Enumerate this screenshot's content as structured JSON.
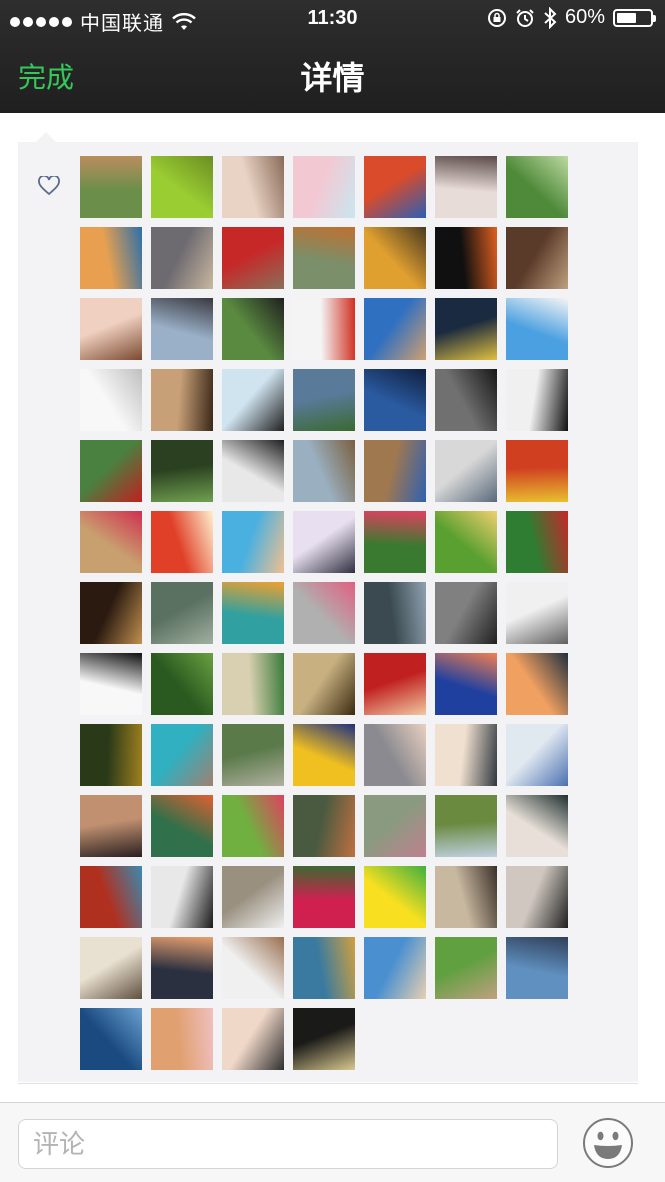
{
  "status_bar": {
    "carrier": "中国联通",
    "time": "11:30",
    "battery_percent": "60%",
    "battery_level": 0.6,
    "icons": [
      "signal-dots-icon",
      "wifi-icon",
      "orientation-lock-icon",
      "alarm-icon",
      "bluetooth-icon",
      "battery-icon"
    ]
  },
  "nav": {
    "done_label": "完成",
    "title": "详情"
  },
  "likes": {
    "icon": "heart-icon",
    "avatars": [
      {
        "c1": "#6b8f4a",
        "c2": "#b98d5e"
      },
      {
        "c1": "#9acd32",
        "c2": "#6b8e23"
      },
      {
        "c1": "#e9d3c4",
        "c2": "#8a6b5a"
      },
      {
        "c1": "#f2c9d3",
        "c2": "#c9e6f0"
      },
      {
        "c1": "#d94b2b",
        "c2": "#2b5fb5"
      },
      {
        "c1": "#e8dcd8",
        "c2": "#5a4a48"
      },
      {
        "c1": "#4f8a3a",
        "c2": "#bcd9a0"
      },
      {
        "c1": "#e8a050",
        "c2": "#2d6fa8"
      },
      {
        "c1": "#6d6a70",
        "c2": "#c9b8a0"
      },
      {
        "c1": "#c62828",
        "c2": "#8a6f5a"
      },
      {
        "c1": "#7a8f6a",
        "c2": "#c07030"
      },
      {
        "c1": "#e0a030",
        "c2": "#4a3a20"
      },
      {
        "c1": "#101010",
        "c2": "#e06020"
      },
      {
        "c1": "#5a3a28",
        "c2": "#c0a080"
      },
      {
        "c1": "#f0d0c0",
        "c2": "#7a4a30"
      },
      {
        "c1": "#9ab0c8",
        "c2": "#3a3a40"
      },
      {
        "c1": "#5a8a40",
        "c2": "#202020"
      },
      {
        "c1": "#f4f4f4",
        "c2": "#d03020"
      },
      {
        "c1": "#3070c0",
        "c2": "#d0a070"
      },
      {
        "c1": "#1a2a40",
        "c2": "#e0c040"
      },
      {
        "c1": "#4aa0e0",
        "c2": "#f5f5f5"
      },
      {
        "c1": "#f8f8f8",
        "c2": "#c0c0c0"
      },
      {
        "c1": "#c8a078",
        "c2": "#3a2818"
      },
      {
        "c1": "#d0e4f0",
        "c2": "#202020"
      },
      {
        "c1": "#5a7a9a",
        "c2": "#3a6a30"
      },
      {
        "c1": "#2a5aa0",
        "c2": "#102040"
      },
      {
        "c1": "#707070",
        "c2": "#181818"
      },
      {
        "c1": "#f0f0f0",
        "c2": "#101010"
      },
      {
        "c1": "#4a8040",
        "c2": "#c02020"
      },
      {
        "c1": "#2a4020",
        "c2": "#70a050"
      },
      {
        "c1": "#e8e8e8",
        "c2": "#202020"
      },
      {
        "c1": "#9ab0c0",
        "c2": "#7a6040"
      },
      {
        "c1": "#a07850",
        "c2": "#3060b0"
      },
      {
        "c1": "#d8d8d8",
        "c2": "#5a6a7a"
      },
      {
        "c1": "#d04020",
        "c2": "#e8c030"
      },
      {
        "c1": "#c8a070",
        "c2": "#d03050"
      },
      {
        "c1": "#e04028",
        "c2": "#fff0d0"
      },
      {
        "c1": "#4ab0e0",
        "c2": "#f0c090"
      },
      {
        "c1": "#e8e0f0",
        "c2": "#303040"
      },
      {
        "c1": "#3a7a30",
        "c2": "#e04060"
      },
      {
        "c1": "#5aa030",
        "c2": "#f0d070"
      },
      {
        "c1": "#2e7d32",
        "c2": "#c62828"
      },
      {
        "c1": "#2a1a10",
        "c2": "#c09050"
      },
      {
        "c1": "#5a7060",
        "c2": "#a0b0a0"
      },
      {
        "c1": "#30a0a0",
        "c2": "#f0a030"
      },
      {
        "c1": "#b0b0b0",
        "c2": "#e06080"
      },
      {
        "c1": "#3a4a50",
        "c2": "#90a0b0"
      },
      {
        "c1": "#808080",
        "c2": "#202020"
      },
      {
        "c1": "#f0f0f0",
        "c2": "#606060"
      },
      {
        "c1": "#f8f8f8",
        "c2": "#101010"
      },
      {
        "c1": "#2a5a20",
        "c2": "#6aa040"
      },
      {
        "c1": "#d8d0b0",
        "c2": "#3a7a3a"
      },
      {
        "c1": "#c8b080",
        "c2": "#3a2a10"
      },
      {
        "c1": "#c02020",
        "c2": "#f0c8a0"
      },
      {
        "c1": "#2040a0",
        "c2": "#f08050"
      },
      {
        "c1": "#f0a060",
        "c2": "#203040"
      },
      {
        "c1": "#2a3a18",
        "c2": "#a08020"
      },
      {
        "c1": "#30b0c0",
        "c2": "#a08070"
      },
      {
        "c1": "#5a7a4a",
        "c2": "#b0b0a0"
      },
      {
        "c1": "#f0c020",
        "c2": "#203080"
      },
      {
        "c1": "#8a8a90",
        "c2": "#e8d0c0"
      },
      {
        "c1": "#f0e0d0",
        "c2": "#303840"
      },
      {
        "c1": "#e0e8f0",
        "c2": "#4a70b0"
      },
      {
        "c1": "#c09070",
        "c2": "#2a2020"
      },
      {
        "c1": "#30704a",
        "c2": "#e06030"
      },
      {
        "c1": "#70b040",
        "c2": "#e04060"
      },
      {
        "c1": "#4a5a40",
        "c2": "#c07040"
      },
      {
        "c1": "#8a9a80",
        "c2": "#c08090"
      },
      {
        "c1": "#6a8a40",
        "c2": "#c0d0e0"
      },
      {
        "c1": "#e8e0d8",
        "c2": "#203030"
      },
      {
        "c1": "#b03020",
        "c2": "#3a8ab0"
      },
      {
        "c1": "#e8e8e8",
        "c2": "#1a1a1a"
      },
      {
        "c1": "#9a9080",
        "c2": "#f0f0f0"
      },
      {
        "c1": "#d02050",
        "c2": "#3a6a30"
      },
      {
        "c1": "#f8e020",
        "c2": "#40b040"
      },
      {
        "c1": "#c8b8a0",
        "c2": "#3a3028"
      },
      {
        "c1": "#d0c8c0",
        "c2": "#202020"
      },
      {
        "c1": "#e8e0d0",
        "c2": "#605040"
      },
      {
        "c1": "#2a3040",
        "c2": "#e8a070"
      },
      {
        "c1": "#f0f0f0",
        "c2": "#9a7050"
      },
      {
        "c1": "#3a7aa0",
        "c2": "#d0a040"
      },
      {
        "c1": "#4a90d0",
        "c2": "#e8d0b0"
      },
      {
        "c1": "#60a040",
        "c2": "#c0a080"
      },
      {
        "c1": "#6090c0",
        "c2": "#30405a"
      },
      {
        "c1": "#1a4a80",
        "c2": "#6aa0d0"
      },
      {
        "c1": "#e0a070",
        "c2": "#f0c0c0"
      },
      {
        "c1": "#f0d8c8",
        "c2": "#303030"
      },
      {
        "c1": "#1a1a18",
        "c2": "#d8c890"
      }
    ]
  },
  "comment": {
    "placeholder": "评论",
    "emoji_icon": "emoji-face-icon"
  }
}
